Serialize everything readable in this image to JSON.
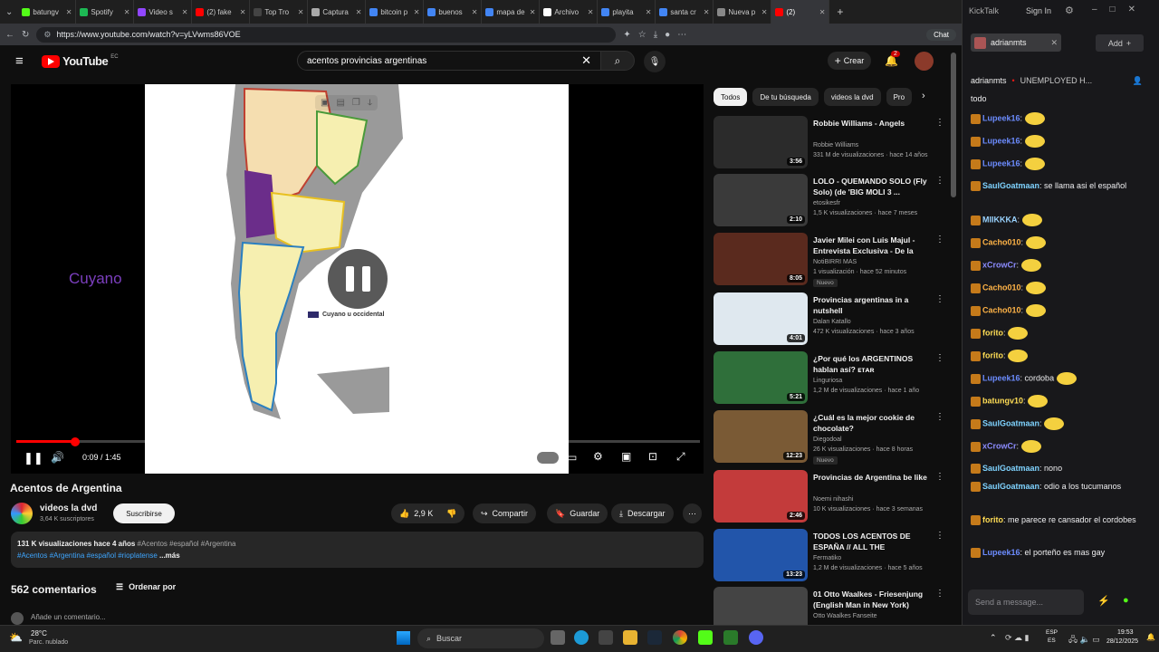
{
  "browser": {
    "tabs": [
      {
        "label": "batungv",
        "color": "#53fc18"
      },
      {
        "label": "Spotify",
        "color": "#1db954"
      },
      {
        "label": "Video s",
        "color": "#9146ff"
      },
      {
        "label": "(2) fake",
        "color": "#ff0000"
      },
      {
        "label": "Top Tro",
        "color": "#444444"
      },
      {
        "label": "Captura",
        "color": "#aaaaaa"
      },
      {
        "label": "bitcoin p",
        "color": "#4285f4"
      },
      {
        "label": "buenos",
        "color": "#4285f4"
      },
      {
        "label": "mapa de",
        "color": "#4285f4"
      },
      {
        "label": "Archivo",
        "color": "#ffffff"
      },
      {
        "label": "playita",
        "color": "#4285f4"
      },
      {
        "label": "santa cr",
        "color": "#4285f4"
      },
      {
        "label": "Nueva p",
        "color": "#888888"
      },
      {
        "label": "(2)",
        "color": "#ff0000"
      }
    ],
    "url": "https://www.youtube.com/watch?v=yLVwms86VOE",
    "chat_label": "Chat"
  },
  "youtube": {
    "logo": "YouTube",
    "logo_sup": "EC",
    "search_value": "acentos provincias argentinas",
    "create_label": "Crear",
    "notif_count": "2",
    "player": {
      "overlay_text": "Cuyano",
      "legend_text": "Cuyano u occidental",
      "time": "0:09 / 1:45",
      "progress": 0.086
    },
    "video": {
      "title": "Acentos de Argentina",
      "channel": "videos la dvd",
      "subscribers": "3,64 K suscriptores",
      "subscribe_label": "Suscribirse",
      "likes": "2,9 K",
      "share_label": "Compartir",
      "save_label": "Guardar",
      "download_label": "Descargar",
      "desc_stats": "131 K visualizaciones  hace 4 años",
      "desc_tags1": "#Acentos #español #Argentina",
      "desc_tags2": "#Acentos #Argentina #español #rioplatense",
      "desc_more": "...más"
    },
    "comments": {
      "count": "562 comentarios",
      "sort_label": "Ordenar por",
      "add_placeholder": "Añade un comentario..."
    },
    "chips": [
      "Todos",
      "De tu búsqueda",
      "videos la dvd",
      "Pro"
    ],
    "recommendations": [
      {
        "title": "Robbie Williams - Angels",
        "channel": "Robbie Williams",
        "meta": "331 M de visualizaciones · hace 14 años",
        "duration": "3:56",
        "badge": "",
        "thumb": "#2b2b2b"
      },
      {
        "title": "LOLO - QUEMANDO SOLO (Fly Solo) (de 'BIG MOLI 3 ...",
        "channel": "etosikesfr",
        "meta": "1,5 K visualizaciones · hace 7 meses",
        "duration": "2:10",
        "badge": "",
        "thumb": "#3a3a3a"
      },
      {
        "title": "Javier Milei con Luis Majul - Entrevista Exclusiva - De la Le...",
        "channel": "NotiBIRRI MAS",
        "meta": "1 visualización · hace 52 minutos",
        "duration": "8:05",
        "badge": "Nuevo",
        "thumb": "#5a2a1e"
      },
      {
        "title": "Provincias argentinas in a nutshell",
        "channel": "Dalan Katallo",
        "meta": "472 K visualizaciones · hace 3 años",
        "duration": "4:01",
        "badge": "",
        "thumb": "#dfe8ef"
      },
      {
        "title": "¿Por qué los ARGENTINOS hablan así? ᴇᴛᴀʀ",
        "channel": "Linguriosa",
        "meta": "1,2 M de visualizaciones · hace 1 año",
        "duration": "5:21",
        "badge": "",
        "thumb": "#2f6f3a"
      },
      {
        "title": "¿Cuál es la mejor cookie de chocolate?",
        "channel": "Diegodoal",
        "meta": "26 K visualizaciones · hace 8 horas",
        "duration": "12:23",
        "badge": "Nuevo",
        "thumb": "#7a5a35"
      },
      {
        "title": "Provincias de Argentina be like",
        "channel": "Noemi nihashi",
        "meta": "10 K visualizaciones · hace 3 semanas",
        "duration": "2:46",
        "badge": "",
        "thumb": "#c33b3b"
      },
      {
        "title": "TODOS LOS ACENTOS DE ESPAÑA // ALL THE ACCENTS...",
        "channel": "Fermatiko",
        "meta": "1,2 M de visualizaciones · hace 5 años",
        "duration": "13:23",
        "badge": "",
        "thumb": "#2255aa"
      },
      {
        "title": "01 Otto Waalkes - Friesenjung (English Man in New York)",
        "channel": "Otto Waalkes Fanseite",
        "meta": "",
        "duration": "",
        "badge": "",
        "thumb": "#444444"
      }
    ]
  },
  "kick": {
    "app_title": "KickTalk",
    "sign_in": "Sign In",
    "channel_tab": "adrianmts",
    "add_label": "Add",
    "stream_user": "adrianmts",
    "stream_title": "UNEMPLOYED H...",
    "first_line": "todo",
    "messages": [
      {
        "user": "Lupeek16",
        "text": "",
        "color": "#6c8cff",
        "emote": true
      },
      {
        "user": "Lupeek16",
        "text": "",
        "color": "#6c8cff",
        "emote": true
      },
      {
        "user": "Lupeek16",
        "text": "",
        "color": "#6c8cff",
        "emote": true
      },
      {
        "user": "SaulGoatmaan",
        "text": "se llama asi el español",
        "color": "#7fd3ff",
        "emote": false
      },
      {
        "user": "MIIKKKA",
        "text": "",
        "color": "#9ad3ff",
        "emote": true
      },
      {
        "user": "Cacho010",
        "text": "",
        "color": "#ffb347",
        "emote": true
      },
      {
        "user": "xCrowCr",
        "text": "",
        "color": "#8c8cff",
        "emote": true
      },
      {
        "user": "Cacho010",
        "text": "",
        "color": "#ffb347",
        "emote": true
      },
      {
        "user": "Cacho010",
        "text": "",
        "color": "#ffb347",
        "emote": true
      },
      {
        "user": "forito",
        "text": "",
        "color": "#ffdd55",
        "emote": true
      },
      {
        "user": "forito",
        "text": "",
        "color": "#ffdd55",
        "emote": true
      },
      {
        "user": "Lupeek16",
        "text": "cordoba",
        "color": "#6c8cff",
        "emote": true
      },
      {
        "user": "batungv10",
        "text": "",
        "color": "#ffdd55",
        "emote": true
      },
      {
        "user": "SaulGoatmaan",
        "text": "",
        "color": "#7fd3ff",
        "emote": true
      },
      {
        "user": "xCrowCr",
        "text": "",
        "color": "#8c8cff",
        "emote": true
      },
      {
        "user": "SaulGoatmaan",
        "text": "nono",
        "color": "#7fd3ff",
        "emote": false
      },
      {
        "user": "SaulGoatmaan",
        "text": "odio a los tucumanos",
        "color": "#7fd3ff",
        "emote": false
      },
      {
        "user": "forito",
        "text": "me parece re cansador el cordobes",
        "color": "#ffdd55",
        "emote": false
      },
      {
        "user": "Lupeek16",
        "text": "el porteño es mas gay",
        "color": "#6c8cff",
        "emote": false
      }
    ],
    "send_placeholder": "Send a message..."
  },
  "taskbar": {
    "weather_temp": "28°C",
    "weather_desc": "Parc. nublado",
    "search_label": "Buscar",
    "lang1": "ESP",
    "lang2": "ES",
    "time": "19:53",
    "date": "28/12/2025"
  }
}
